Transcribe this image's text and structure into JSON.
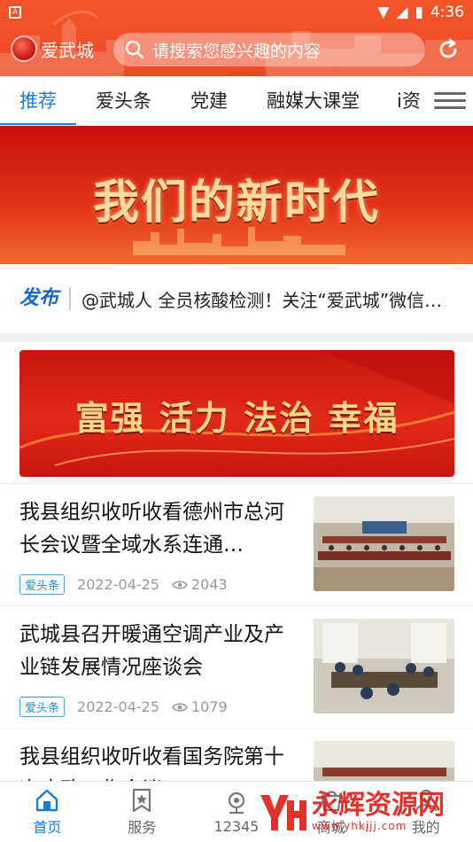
{
  "status_bar": {
    "time": "4:36",
    "left_icon": "A"
  },
  "header": {
    "logo_text": "爱武城",
    "search_placeholder": "请搜索您感兴趣的内容"
  },
  "tabs": [
    {
      "label": "推荐",
      "active": true
    },
    {
      "label": "爱头条",
      "active": false
    },
    {
      "label": "党建",
      "active": false
    },
    {
      "label": "融媒大课堂",
      "active": false
    },
    {
      "label": "i资",
      "active": false
    }
  ],
  "banner_top": {
    "title": "我们的新时代"
  },
  "notice": {
    "brand": "发布",
    "text": "@武城人 全员核酸检测！关注“爱武城”微信…"
  },
  "banner_mid": {
    "title": "富强 活力 法治 幸福"
  },
  "news": [
    {
      "title": "我县组织收听收看德州市总河长会议暨全域水系连通…",
      "tag": "爱头条",
      "date": "2022-04-25",
      "views": "2043"
    },
    {
      "title": "武城县召开暖通空调产业及产业链发展情况座谈会",
      "tag": "爱头条",
      "date": "2022-04-25",
      "views": "1079"
    },
    {
      "title": "我县组织收听收看国务院第十次廉政工作会议",
      "tag": "",
      "date": "",
      "views": ""
    }
  ],
  "bottom_nav": [
    {
      "label": "首页",
      "icon": "home-icon",
      "active": true
    },
    {
      "label": "服务",
      "icon": "bookmark-star-icon",
      "active": false
    },
    {
      "label": "12345",
      "icon": "location-icon",
      "active": false
    },
    {
      "label": "商城",
      "icon": "shop-icon",
      "active": false
    },
    {
      "label": "我的",
      "icon": "user-icon",
      "active": false
    }
  ],
  "watermark": {
    "name": "永辉资源网",
    "url": "www.yhkjjj.com"
  },
  "colors": {
    "brand_red": "#ef4a26",
    "accent_blue": "#1a7fd4"
  }
}
